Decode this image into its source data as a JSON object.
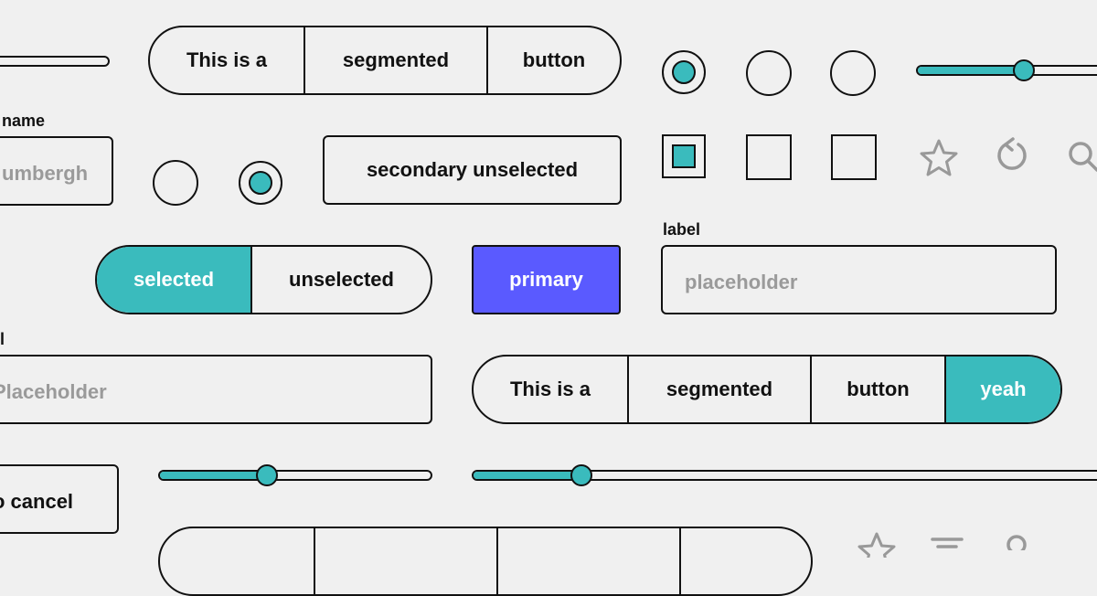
{
  "colors": {
    "accent": "#3abbbd",
    "primary": "#5a5aff",
    "ink": "#111111",
    "placeholder": "#9a9a9a",
    "background": "#f0f0f0"
  },
  "segmented_top": {
    "segments": [
      "This is a",
      "segmented",
      "button"
    ]
  },
  "name_field": {
    "label": "name",
    "placeholder": "umbergh"
  },
  "secondary_button": {
    "label": "secondary unselected"
  },
  "toggle": {
    "selected": "selected",
    "unselected": "unselected"
  },
  "primary_button": {
    "label": "primary"
  },
  "label_field": {
    "label": "label",
    "placeholder": "placeholder"
  },
  "left_field": {
    "label": "el",
    "placeholder": "Placeholder"
  },
  "segmented_mid": {
    "segments": [
      "This is a",
      "segmented",
      "button",
      "yeah"
    ]
  },
  "cancel_button": {
    "label": "o cancel"
  },
  "sliders": {
    "top_right": 0.6,
    "small": 0.4,
    "wide": 0.17,
    "top_left_line": 1.0
  },
  "icons": [
    "star-icon",
    "refresh-icon",
    "search-icon",
    "filter-icon",
    "user-icon"
  ]
}
